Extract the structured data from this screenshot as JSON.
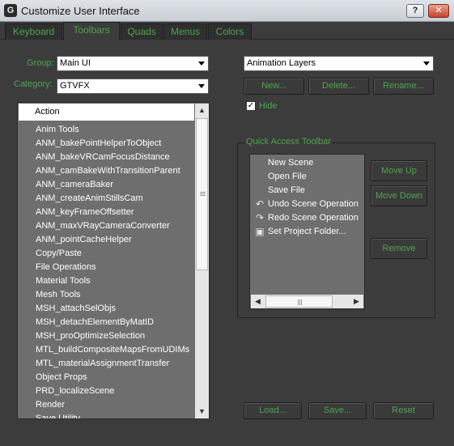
{
  "window": {
    "title": "Customize User Interface",
    "help_label": "?",
    "close_label": "✕",
    "app_icon_label": "G"
  },
  "tabs": [
    {
      "label": "Keyboard"
    },
    {
      "label": "Toolbars"
    },
    {
      "label": "Quads"
    },
    {
      "label": "Menus"
    },
    {
      "label": "Colors"
    }
  ],
  "active_tab": "Toolbars",
  "group": {
    "label": "Group:",
    "value": "Main UI"
  },
  "category": {
    "label": "Category:",
    "value": "GTVFX"
  },
  "action_list": {
    "header": "Action",
    "items": [
      "Anim Tools",
      "ANM_bakePointHelperToObject",
      "ANM_bakeVRCamFocusDistance",
      "ANM_camBakeWithTransitionParent",
      "ANM_cameraBaker",
      "ANM_createAnimStillsCam",
      "ANM_keyFrameOffsetter",
      "ANM_maxVRayCameraConverter",
      "ANM_pointCacheHelper",
      "Copy/Paste",
      "File Operations",
      "Material Tools",
      "Mesh Tools",
      "MSH_attachSelObjs",
      "MSH_detachElementByMatID",
      "MSH_proOptimizeSelection",
      "MTL_buildCompositeMapsFromUDIMs",
      "MTL_materialAssignmentTransfer",
      "Object Props",
      "PRD_localizeScene",
      "Render",
      "Save Utility"
    ]
  },
  "toolbar_select": {
    "value": "Animation Layers"
  },
  "toolbar_buttons": {
    "new": "New...",
    "delete": "Delete...",
    "rename": "Rename..."
  },
  "hide": {
    "label": "Hide",
    "checked": true,
    "check_mark": "✓"
  },
  "quick_access": {
    "title": "Quick Access Toolbar",
    "items": [
      {
        "label": "New Scene",
        "icon": ""
      },
      {
        "label": "Open File",
        "icon": ""
      },
      {
        "label": "Save File",
        "icon": ""
      },
      {
        "label": "Undo Scene Operation",
        "icon": "undo-icon"
      },
      {
        "label": "Redo Scene Operation",
        "icon": "redo-icon"
      },
      {
        "label": "Set Project Folder...",
        "icon": "project-folder-icon"
      }
    ],
    "move_up": "Move Up",
    "move_down": "Move Down",
    "remove": "Remove"
  },
  "bottom_buttons": {
    "load": "Load...",
    "save": "Save...",
    "reset": "Reset"
  },
  "colors": {
    "accent": "#4ea54e",
    "panel": "#3c3c3c",
    "list_bg": "#6e6e6e"
  }
}
